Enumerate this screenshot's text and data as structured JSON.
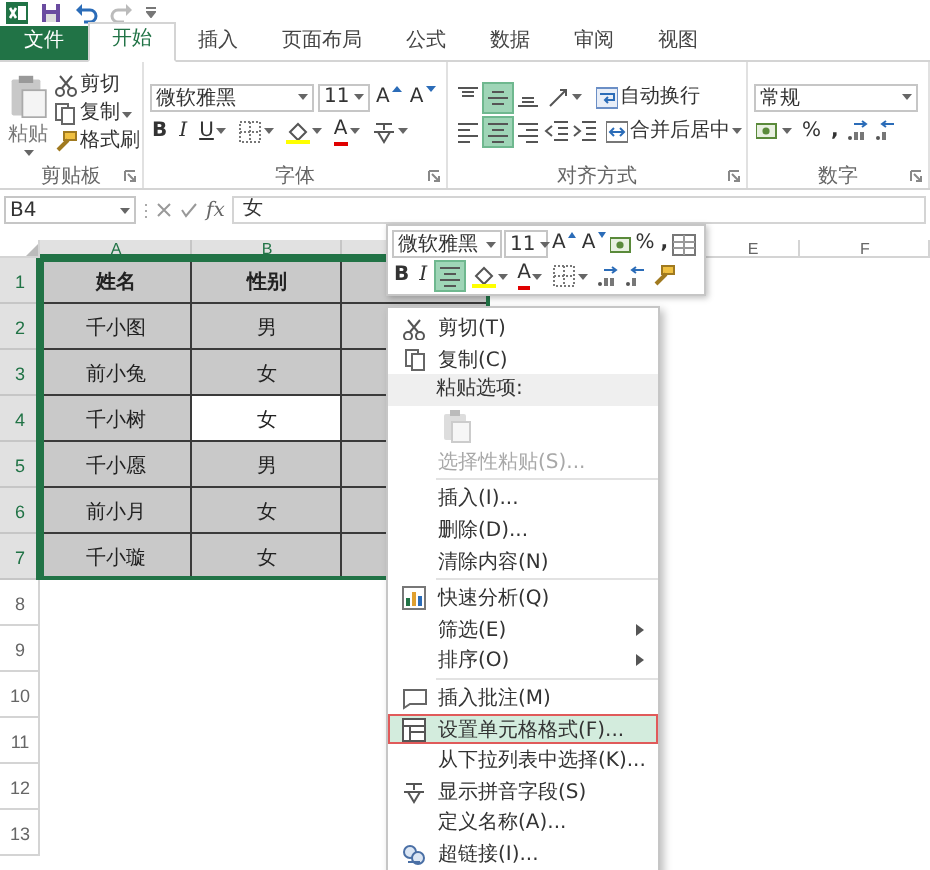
{
  "quick_access": {
    "redo": {
      "disabled": true
    }
  },
  "tabs": [
    {
      "label": "文件",
      "kind": "file",
      "selected": false
    },
    {
      "label": "开始",
      "kind": "tab",
      "selected": true
    },
    {
      "label": "插入",
      "kind": "tab",
      "selected": false
    },
    {
      "label": "页面布局",
      "kind": "tab",
      "selected": false
    },
    {
      "label": "公式",
      "kind": "tab",
      "selected": false
    },
    {
      "label": "数据",
      "kind": "tab",
      "selected": false
    },
    {
      "label": "审阅",
      "kind": "tab",
      "selected": false
    },
    {
      "label": "视图",
      "kind": "tab",
      "selected": false
    }
  ],
  "ribbon": {
    "clipboard": {
      "label": "剪贴板",
      "paste": "粘贴",
      "cut": "剪切",
      "copy": "复制",
      "format_painter": "格式刷"
    },
    "font": {
      "label": "字体",
      "font_name": "微软雅黑",
      "font_size": "11",
      "grow": "A",
      "shrink": "A",
      "bold": "B",
      "italic": "I",
      "underline": "U",
      "font_color": "A"
    },
    "alignment": {
      "label": "对齐方式",
      "vertical": [
        {
          "selected": false
        },
        {
          "selected": true
        },
        {
          "selected": false
        }
      ],
      "horizontal": [
        {
          "selected": false
        },
        {
          "selected": true
        },
        {
          "selected": false
        }
      ],
      "wrap_text": "自动换行",
      "merge": "合并后居中"
    },
    "number": {
      "label": "数字",
      "format": "常规",
      "percent": "%",
      "comma": ","
    }
  },
  "formula_bar": {
    "name_box": "B4",
    "function_label": "fx",
    "value": "女"
  },
  "columns": [
    {
      "label": "A",
      "selected": true
    },
    {
      "label": "B",
      "selected": true
    },
    {
      "selected": true
    },
    {},
    {
      "label": "E",
      "selected": false
    },
    {
      "label": "F",
      "selected": false
    }
  ],
  "rows": [
    {
      "header": "1",
      "selected": true,
      "cells": [
        {
          "text": "姓名",
          "bold": true,
          "active": false
        },
        {
          "text": "性别",
          "bold": true,
          "active": false
        }
      ]
    },
    {
      "header": "2",
      "selected": true,
      "cells": [
        {
          "text": "千小图",
          "bold": false,
          "active": false
        },
        {
          "text": "男",
          "bold": false,
          "active": false
        }
      ]
    },
    {
      "header": "3",
      "selected": true,
      "cells": [
        {
          "text": "前小兔",
          "bold": false,
          "active": false
        },
        {
          "text": "女",
          "bold": false,
          "active": false
        }
      ]
    },
    {
      "header": "4",
      "selected": true,
      "cells": [
        {
          "text": "千小树",
          "bold": false,
          "active": false
        },
        {
          "text": "女",
          "bold": false,
          "active": true
        }
      ]
    },
    {
      "header": "5",
      "selected": true,
      "cells": [
        {
          "text": "千小愿",
          "bold": false,
          "active": false
        },
        {
          "text": "男",
          "bold": false,
          "active": false
        }
      ]
    },
    {
      "header": "6",
      "selected": true,
      "cells": [
        {
          "text": "前小月",
          "bold": false,
          "active": false
        },
        {
          "text": "女",
          "bold": false,
          "active": false
        }
      ]
    },
    {
      "header": "7",
      "selected": true,
      "cells": [
        {
          "text": "千小璇",
          "bold": false,
          "active": false
        },
        {
          "text": "女",
          "bold": false,
          "active": false
        }
      ]
    },
    {
      "header": "8",
      "selected": false
    },
    {
      "header": "9",
      "selected": false
    },
    {
      "header": "10",
      "selected": false
    },
    {
      "header": "11",
      "selected": false
    },
    {
      "header": "12",
      "selected": false
    },
    {
      "header": "13",
      "selected": false
    }
  ],
  "mini_toolbar": {
    "font_name": "微软雅黑",
    "font_size": "11",
    "grow": "A",
    "shrink": "A",
    "percent": "%",
    "comma": ",",
    "bold": "B",
    "italic": "I",
    "align_on": true,
    "font_color": "A"
  },
  "context_menu": [
    {
      "kind": "cut",
      "label": "剪切(T)",
      "disabled": false,
      "selected": false,
      "submenu": false
    },
    {
      "kind": "copy",
      "label": "复制(C)",
      "disabled": false,
      "selected": false,
      "submenu": false
    },
    {
      "kind": "header",
      "label": "粘贴选项:"
    },
    {
      "kind": "paste"
    },
    {
      "kind": "item",
      "label": "选择性粘贴(S)...",
      "disabled": true,
      "selected": false,
      "submenu": false
    },
    {
      "kind": "separator"
    },
    {
      "kind": "item",
      "label": "插入(I)...",
      "disabled": false,
      "selected": false,
      "submenu": false
    },
    {
      "kind": "item",
      "label": "删除(D)...",
      "disabled": false,
      "selected": false,
      "submenu": false
    },
    {
      "kind": "item",
      "label": "清除内容(N)",
      "disabled": false,
      "selected": false,
      "submenu": false
    },
    {
      "kind": "separator"
    },
    {
      "kind": "analysis",
      "label": "快速分析(Q)",
      "disabled": false,
      "selected": false,
      "submenu": false
    },
    {
      "kind": "item",
      "label": "筛选(E)",
      "disabled": false,
      "selected": false,
      "submenu": true
    },
    {
      "kind": "item",
      "label": "排序(O)",
      "disabled": false,
      "selected": false,
      "submenu": true
    },
    {
      "kind": "separator"
    },
    {
      "kind": "comment",
      "label": "插入批注(M)",
      "disabled": false,
      "selected": false,
      "submenu": false
    },
    {
      "kind": "format",
      "label": "设置单元格格式(F)...",
      "disabled": false,
      "selected": true,
      "submenu": false
    },
    {
      "kind": "item",
      "label": "从下拉列表中选择(K)...",
      "disabled": false,
      "selected": false,
      "submenu": false
    },
    {
      "kind": "phonetic",
      "label": "显示拼音字段(S)",
      "disabled": false,
      "selected": false,
      "submenu": false
    },
    {
      "kind": "item",
      "label": "定义名称(A)...",
      "disabled": false,
      "selected": false,
      "submenu": false
    },
    {
      "kind": "link",
      "label": "超链接(I)...",
      "disabled": false,
      "selected": false,
      "submenu": false
    }
  ]
}
